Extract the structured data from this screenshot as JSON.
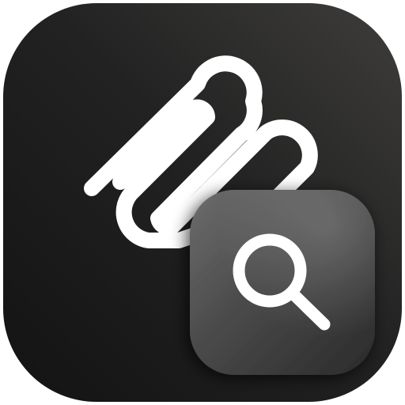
{
  "icon": {
    "name": "clipboard-search-app-icon",
    "glyph": "paperclip-icon",
    "badge_glyph": "magnifying-glass-icon",
    "colors": {
      "tile_dark": "#141414",
      "tile_light": "#3c3c3b",
      "glyph": "#ffffff",
      "badge_dark": "#2c2c2c",
      "badge_light": "#6a6a6a"
    }
  }
}
